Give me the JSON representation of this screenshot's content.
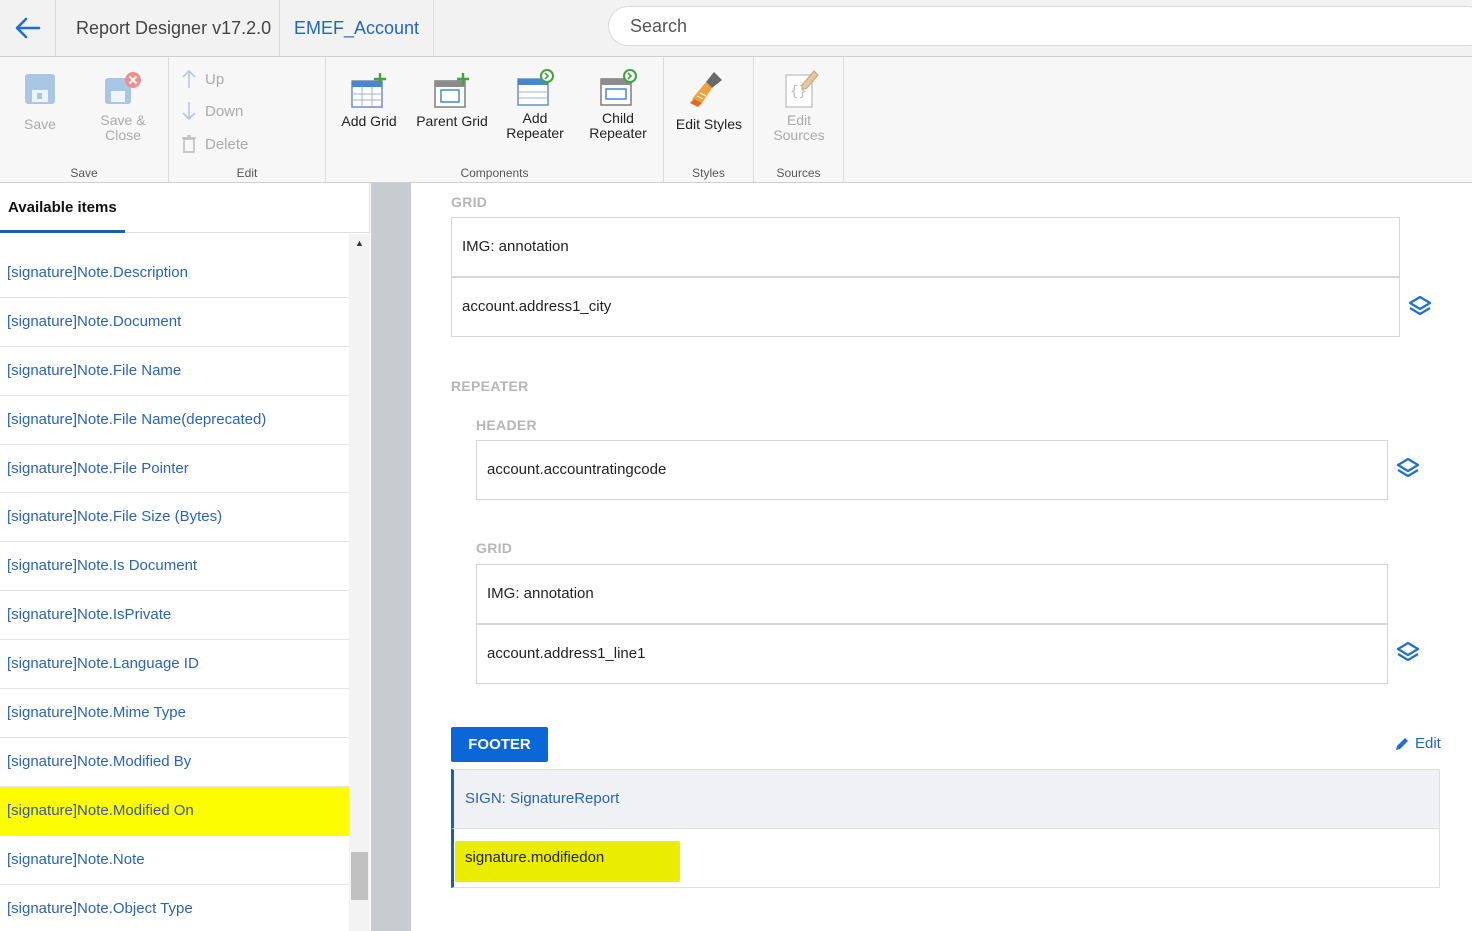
{
  "topbar": {
    "app_title": "Report Designer v17.2.0",
    "entity_tab": "EMEF_Account",
    "search_placeholder": "Search"
  },
  "ribbon": {
    "groups": {
      "save": "Save",
      "edit": "Edit",
      "components": "Components",
      "styles": "Styles",
      "sources": "Sources"
    },
    "buttons": {
      "save": "Save",
      "save_close_1": "Save &",
      "save_close_2": "Close",
      "up": "Up",
      "down": "Down",
      "delete": "Delete",
      "add_grid": "Add Grid",
      "parent_grid": "Parent Grid",
      "add_repeater_1": "Add",
      "add_repeater_2": "Repeater",
      "child_repeater_1": "Child",
      "child_repeater_2": "Repeater",
      "edit_styles": "Edit Styles",
      "edit_sources_1": "Edit",
      "edit_sources_2": "Sources"
    }
  },
  "sidebar": {
    "tab": "Available items",
    "items": [
      "[signature]Note.Description",
      "[signature]Note.Document",
      "[signature]Note.File Name",
      "[signature]Note.File Name(deprecated)",
      "[signature]Note.File Pointer",
      "[signature]Note.File Size (Bytes)",
      "[signature]Note.Is Document",
      "[signature]Note.IsPrivate",
      "[signature]Note.Language ID",
      "[signature]Note.Mime Type",
      "[signature]Note.Modified By",
      "[signature]Note.Modified On",
      "[signature]Note.Note",
      "[signature]Note.Object Type"
    ]
  },
  "main": {
    "grid_label": "GRID",
    "grid_rows": [
      "IMG: annotation",
      "account.address1_city"
    ],
    "repeater_label": "REPEATER",
    "header_label": "HEADER",
    "header_rows": [
      "account.accountratingcode"
    ],
    "inner_grid_label": "GRID",
    "inner_grid_rows": [
      "IMG: annotation",
      "account.address1_line1"
    ],
    "footer_button": "FOOTER",
    "edit_link": "Edit",
    "footer_rows": [
      "SIGN: SignatureReport",
      "signature.modifiedon"
    ]
  },
  "colors": {
    "accent": "#0b67d6",
    "link": "#2a64b0",
    "highlight": "#fcfd00"
  }
}
